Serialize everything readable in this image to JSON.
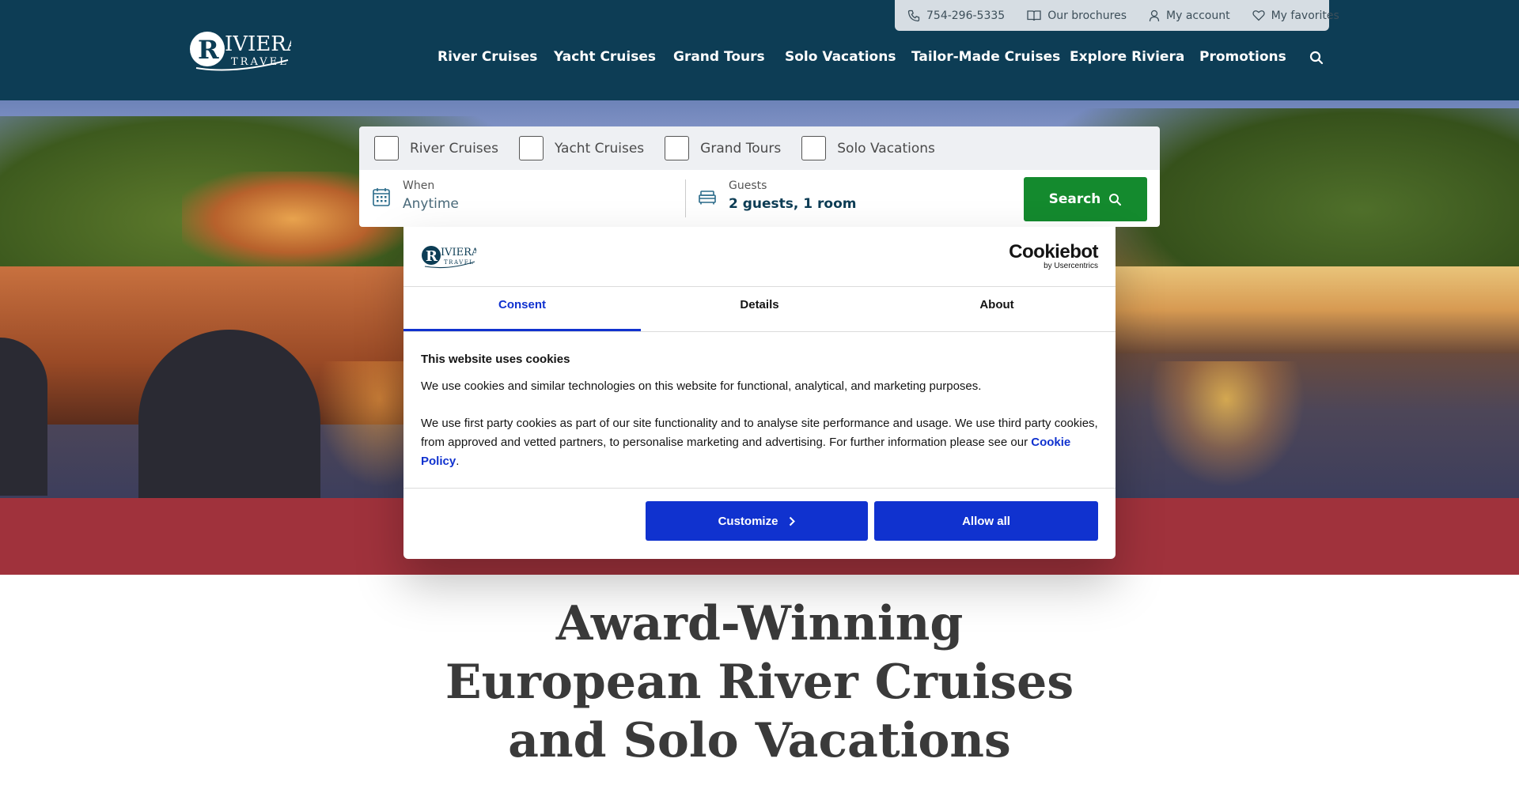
{
  "header": {
    "logo_text": "RIVIERA TRAVEL",
    "utility": {
      "phone": "754-296-5335",
      "brochures": "Our brochures",
      "account": "My account",
      "favorites": "My favorites"
    },
    "nav": [
      "River Cruises",
      "Yacht Cruises",
      "Grand Tours",
      "Solo Vacations",
      "Tailor-Made Cruises",
      "Explore Riviera",
      "Promotions"
    ]
  },
  "search": {
    "categories": [
      "River Cruises",
      "Yacht Cruises",
      "Grand Tours",
      "Solo Vacations"
    ],
    "when_label": "When",
    "when_value": "Anytime",
    "guests_label": "Guests",
    "guests_value": "2 guests, 1 room",
    "button_label": "Search"
  },
  "cookie": {
    "brand": "Cookiebot",
    "brand_by": "by Usercentrics",
    "tabs": [
      "Consent",
      "Details",
      "About"
    ],
    "active_tab": "Consent",
    "title": "This website uses cookies",
    "paragraph1": "We use cookies and similar technologies on this website for functional, analytical, and marketing purposes.",
    "paragraph2_before": "We use first party cookies as part of our site functionality and to analyse site performance and usage. We use third party cookies, from approved and vetted partners, to personalise marketing and advertising. For further information please see our ",
    "paragraph2_link": "Cookie Policy",
    "paragraph2_after": ".",
    "customize_label": "Customize",
    "allow_label": "Allow all",
    "accent_color": "#1032cf"
  },
  "headline": "Award-Winning European River Cruises and Solo Vacations",
  "colors": {
    "header_bg": "#0d3d55",
    "search_button": "#148a2e",
    "band": "#a0323c"
  }
}
